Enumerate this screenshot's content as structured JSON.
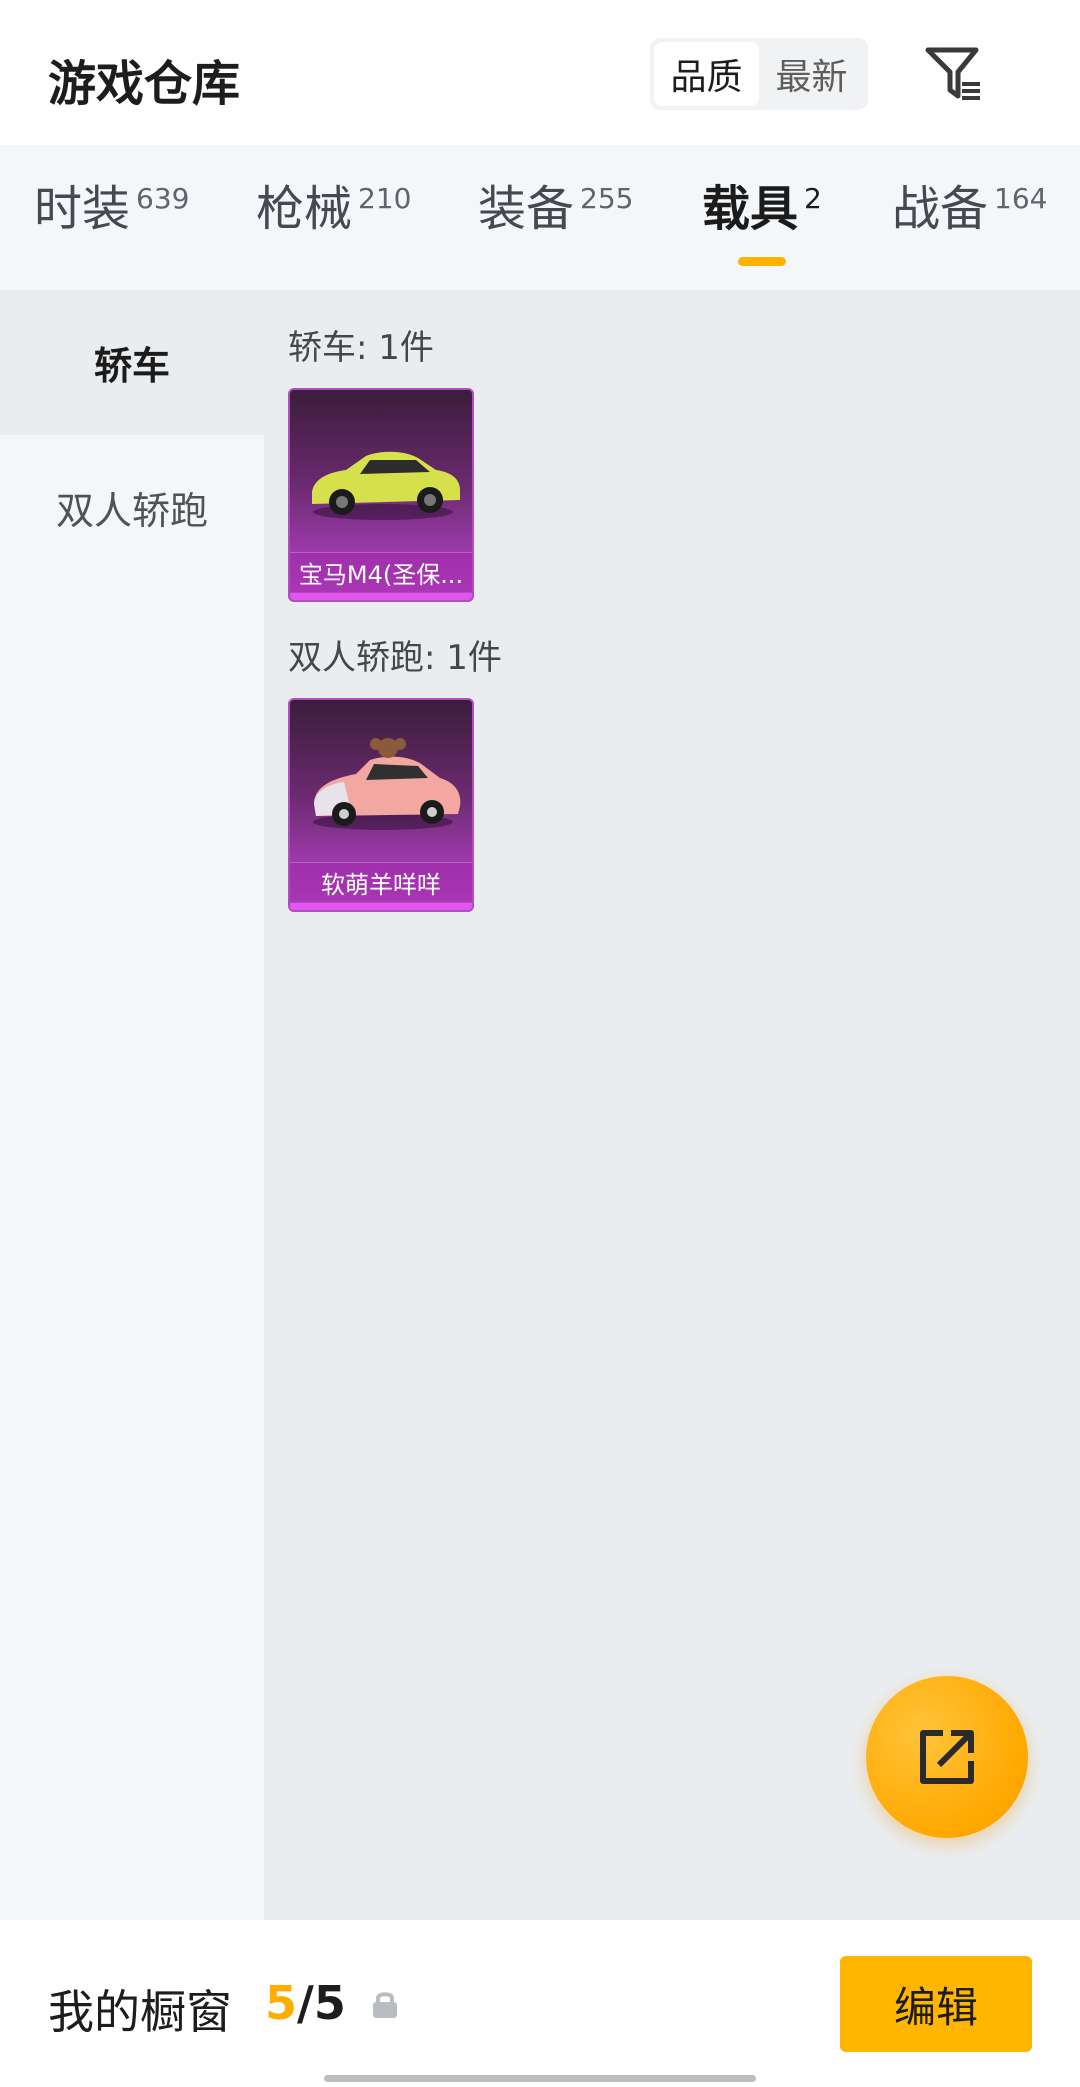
{
  "header": {
    "title": "游戏仓库",
    "sort_options": [
      "品质",
      "最新"
    ],
    "sort_selected": "品质",
    "filter_icon": "filter-icon"
  },
  "tabs": [
    {
      "label": "时装",
      "count": "639"
    },
    {
      "label": "枪械",
      "count": "210"
    },
    {
      "label": "装备",
      "count": "255"
    },
    {
      "label": "载具",
      "count": "2"
    },
    {
      "label": "战备",
      "count": "164"
    }
  ],
  "active_tab": "载具",
  "sidebar": {
    "items": [
      {
        "label": "轿车"
      },
      {
        "label": "双人轿跑"
      }
    ],
    "active": "轿车"
  },
  "groups": [
    {
      "title": "轿车: 1件",
      "items": [
        {
          "name": "宝马M4(圣保...",
          "car_color": "#d6e04a"
        }
      ]
    },
    {
      "title": "双人轿跑: 1件",
      "items": [
        {
          "name": "软萌羊咩咩",
          "car_color": "#f2a7a0"
        }
      ]
    }
  ],
  "fab": {
    "icon": "share-icon"
  },
  "bottom_bar": {
    "label": "我的橱窗",
    "count_current": "5",
    "count_sep": "/",
    "count_total": "5",
    "lock_icon": "lock-icon",
    "edit_label": "编辑"
  },
  "colors": {
    "accent": "#ffb300",
    "card_purple": "#a23bb0"
  }
}
